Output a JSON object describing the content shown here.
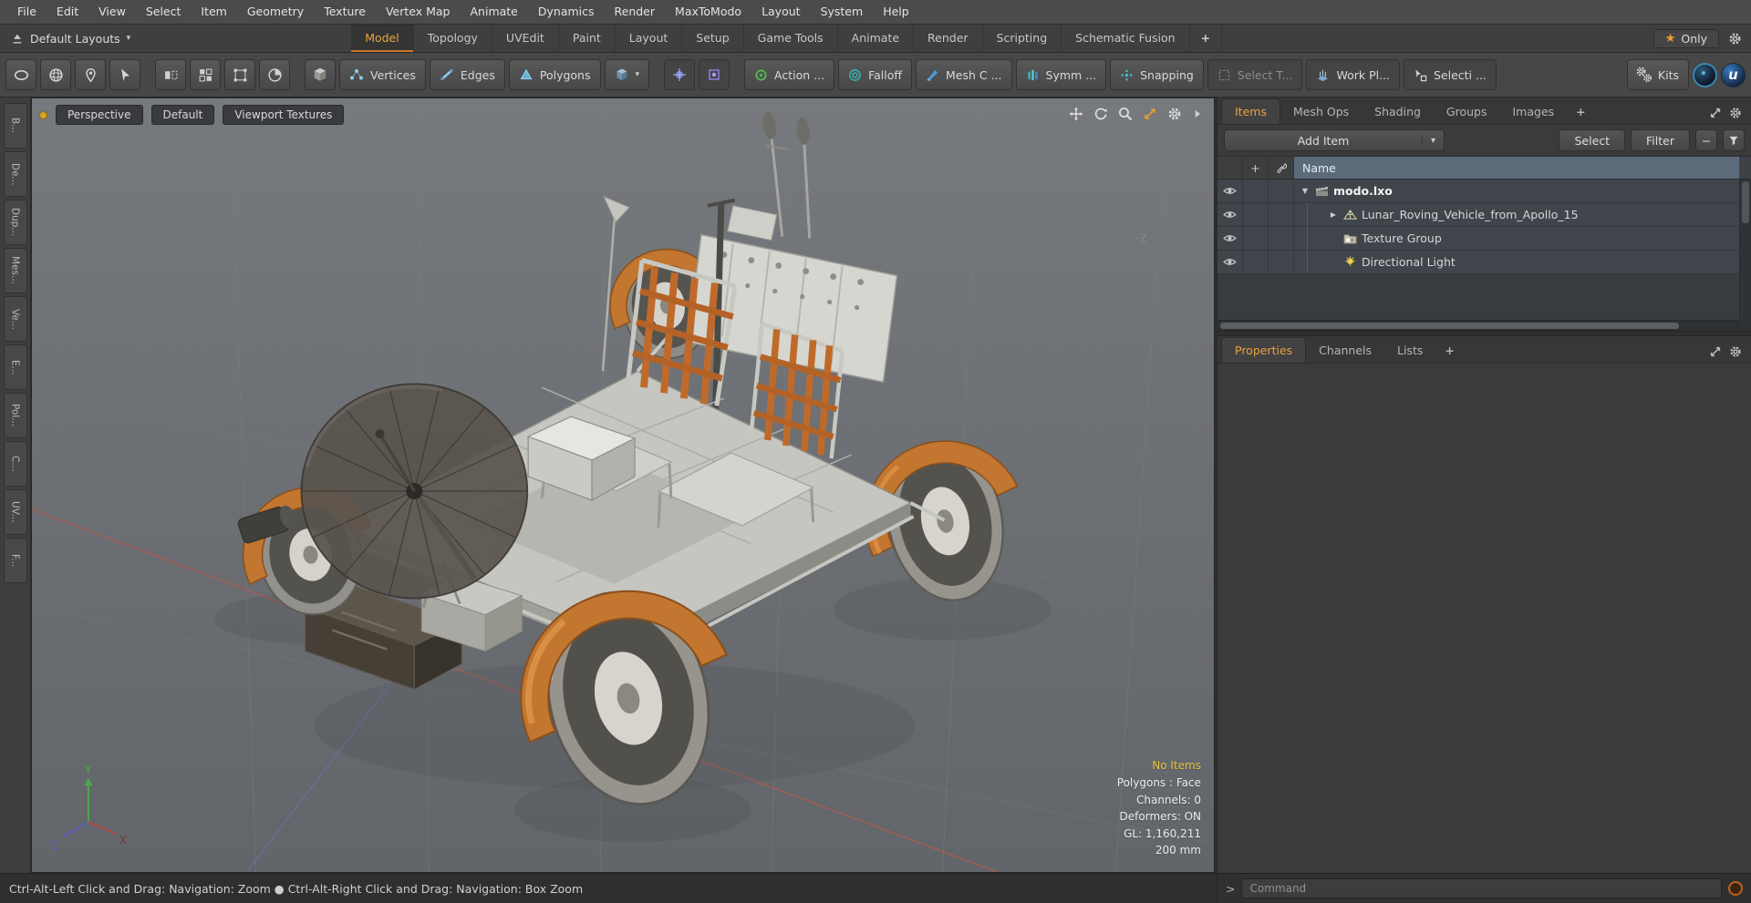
{
  "colors": {
    "accent_orange": "#e8a23e",
    "fender_orange": "#c2762f",
    "header_blue": "#5c6b7a",
    "warning_yellow": "#e6c23a"
  },
  "icons": {
    "star": "★",
    "dropdown": "▾",
    "disclosure_open": "▼",
    "disclosure_closed": "▶",
    "plus": "+",
    "minus": "−"
  },
  "menu": {
    "items": [
      "File",
      "Edit",
      "View",
      "Select",
      "Item",
      "Geometry",
      "Texture",
      "Vertex Map",
      "Animate",
      "Dynamics",
      "Render",
      "MaxToModo",
      "Layout",
      "System",
      "Help"
    ]
  },
  "layout_bar": {
    "layouts_label": "Default Layouts",
    "tabs": [
      "Model",
      "Topology",
      "UVEdit",
      "Paint",
      "Layout",
      "Setup",
      "Game Tools",
      "Animate",
      "Render",
      "Scripting",
      "Schematic Fusion"
    ],
    "active_tab": "Model",
    "add_tab_label": "+",
    "only_label": "Only"
  },
  "toolbar": {
    "vertices_label": "Vertices",
    "edges_label": "Edges",
    "polygons_label": "Polygons",
    "action_label": "Action  ...",
    "falloff_label": "Falloff",
    "mesh_constraints_label": "Mesh C ...",
    "symmetry_label": "Symm ...",
    "snapping_label": "Snapping",
    "select_through_label": "Select T...",
    "work_plane_label": "Work Pl...",
    "selection_sets_label": "Selecti ...",
    "kits_label": "Kits",
    "modo_logo_letter": "u"
  },
  "left_tabs": {
    "items": [
      "B...",
      "De...",
      "Dup...",
      "Mes...",
      "Ve...",
      "E...",
      "Pol...",
      "C...",
      "UV...",
      "F..."
    ]
  },
  "viewport": {
    "perspective_label": "Perspective",
    "style_label": "Default",
    "textures_label": "Viewport Textures",
    "axis_label_negz": "-Z",
    "gizmo": {
      "x": "X",
      "y": "Y",
      "z": "Z"
    },
    "info": {
      "no_items": "No Items",
      "polygons": "Polygons : Face",
      "channels": "Channels: 0",
      "deformers": "Deformers: ON",
      "gl": "GL: 1,160,211",
      "grid_size": "200 mm"
    }
  },
  "item_list": {
    "tabs": [
      "Items",
      "Mesh Ops",
      "Shading",
      "Groups",
      "Images"
    ],
    "active_tab": "Items",
    "add_tab_label": "+",
    "add_item_label": "Add Item",
    "select_label": "Select",
    "filter_label": "Filter",
    "name_header": "Name",
    "rows": [
      {
        "label": "modo.lxo"
      },
      {
        "label": "Lunar_Roving_Vehicle_from_Apollo_15"
      },
      {
        "label": "Texture Group"
      },
      {
        "label": "Directional Light"
      }
    ]
  },
  "properties_panel": {
    "tabs": [
      "Properties",
      "Channels",
      "Lists"
    ],
    "active_tab": "Properties",
    "add_tab_label": "+"
  },
  "command": {
    "prompt": ">",
    "placeholder": "Command"
  },
  "status_bar": {
    "text": "Ctrl-Alt-Left Click and Drag: Navigation: Zoom  ●  Ctrl-Alt-Right Click and Drag: Navigation: Box Zoom"
  }
}
